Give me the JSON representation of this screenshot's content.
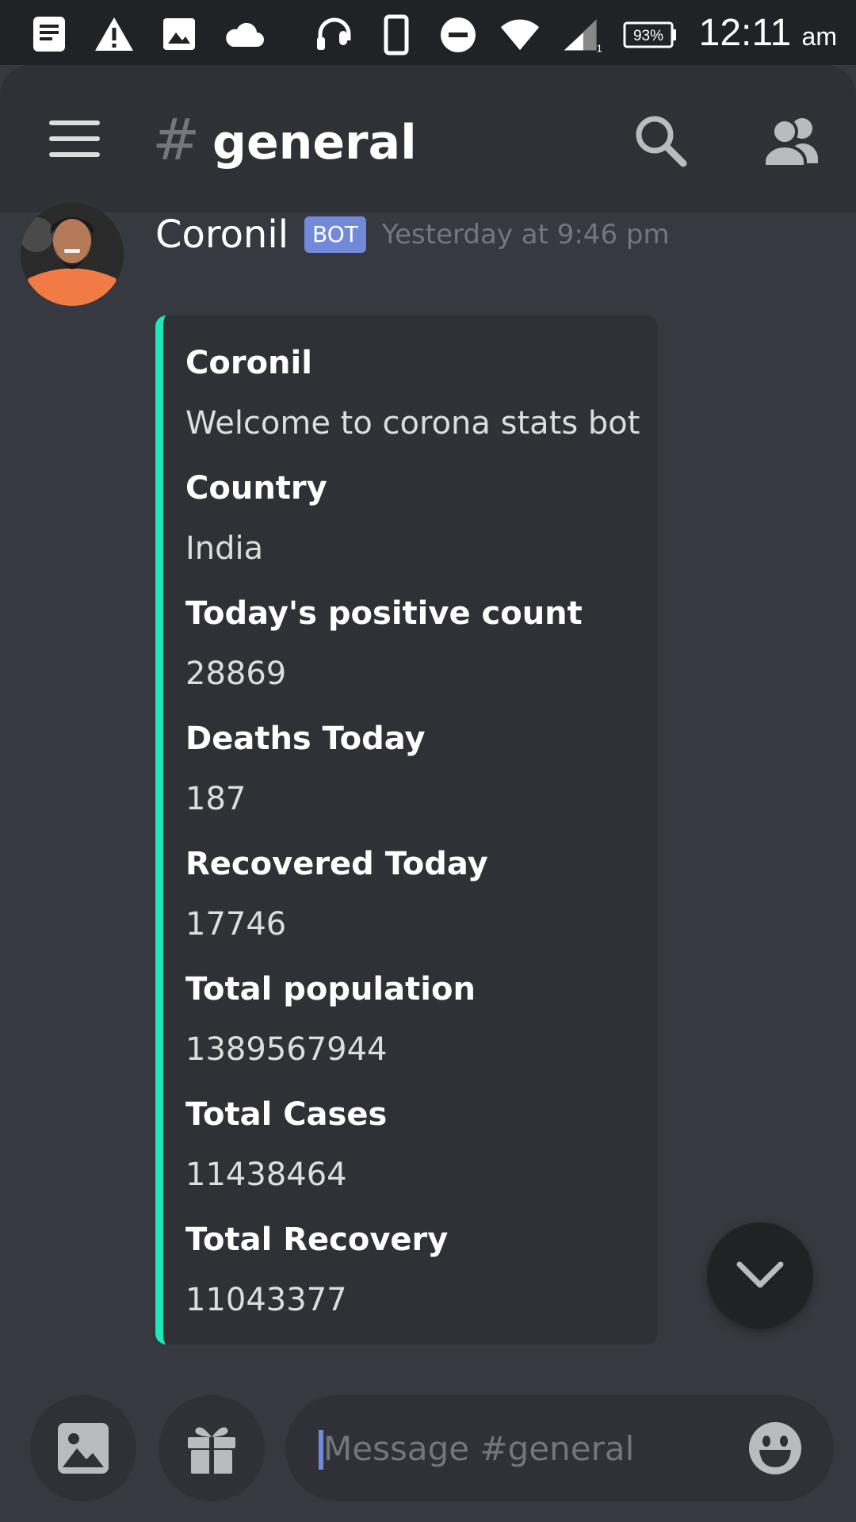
{
  "status_bar": {
    "battery": "93%",
    "time": "12:11",
    "ampm": "am"
  },
  "header": {
    "channel_hash": "#",
    "channel_name": "general"
  },
  "message": {
    "author": "Coronil",
    "tag": "BOT",
    "timestamp": "Yesterday at 9:46 pm",
    "accent_color": "#1de9b6",
    "embed": {
      "fields": [
        {
          "name": "Coronil",
          "value": "Welcome to corona stats bot"
        },
        {
          "name": "Country",
          "value": "India"
        },
        {
          "name": "Today's positive count",
          "value": "28869"
        },
        {
          "name": "Deaths Today",
          "value": "187"
        },
        {
          "name": "Recovered Today",
          "value": "17746"
        },
        {
          "name": "Total population",
          "value": "1389567944"
        },
        {
          "name": "Total Cases",
          "value": "11438464"
        },
        {
          "name": "Total Recovery",
          "value": "11043377"
        }
      ]
    }
  },
  "composer": {
    "placeholder": "Message #general"
  }
}
